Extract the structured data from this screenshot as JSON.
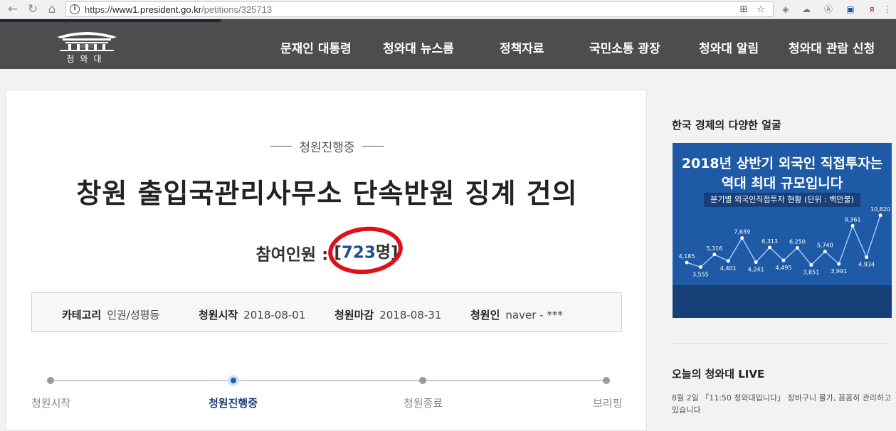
{
  "browser": {
    "url_scheme": "https://",
    "url_host": "www1.president.go.kr",
    "url_path": "/petitions/325713",
    "info_icon": "i"
  },
  "header": {
    "logo_small": "대한민국",
    "logo_text": "청와대",
    "menu": [
      "문재인 대통령",
      "청와대 뉴스룸",
      "정책자료",
      "국민소통 광장",
      "청와대 알림",
      "청와대 관람 신청"
    ]
  },
  "petition": {
    "status": "청원진행중",
    "title": "창원 출입국관리사무소 단속반원 징계 건의",
    "count_label": "참여인원 :",
    "count_open": "[",
    "count_value": "723",
    "count_unit": "명",
    "count_close": "]",
    "info": [
      {
        "key": "카테고리",
        "value": "인권/성평등"
      },
      {
        "key": "청원시작",
        "value": "2018-08-01"
      },
      {
        "key": "청원마감",
        "value": "2018-08-31"
      },
      {
        "key": "청원인",
        "value": "naver - ***"
      }
    ],
    "steps": [
      "청원시작",
      "청원진행중",
      "청원종료",
      "브리핑"
    ],
    "active_step": 1
  },
  "sidebar": {
    "section1_title": "한국 경제의 다양한 얼굴",
    "banner": {
      "headline1": "2018년 상반기 외국인 직접투자는",
      "headline2": "역대 최대 규모입니다",
      "subtitle": "분기별 외국인직접투자 현황 (단위 : 백만불)",
      "values": [
        4185,
        3555,
        5316,
        4401,
        7639,
        4241,
        6313,
        4495,
        6250,
        3851,
        5740,
        3991,
        9361,
        4934,
        10820
      ],
      "value_labels": [
        "4,185",
        "3,555",
        "5,316",
        "4,401",
        "7,639",
        "4,241",
        "6,313",
        "4,495",
        "6,250",
        "3,851",
        "5,740",
        "3,991",
        "9,361",
        "4,934",
        "10,820"
      ]
    },
    "section2_title": "오늘의 청와대 LIVE",
    "news_text": "8월 2일 「11:50 청와대입니다」 장바구니 물가, 꼼꼼히 관리하고 있습니다"
  },
  "colors": {
    "header_bg": "#4d4d4d",
    "accent_blue": "#1f4c8f",
    "highlight_red": "#e0101a",
    "banner_bg": "#1e5aa5"
  }
}
